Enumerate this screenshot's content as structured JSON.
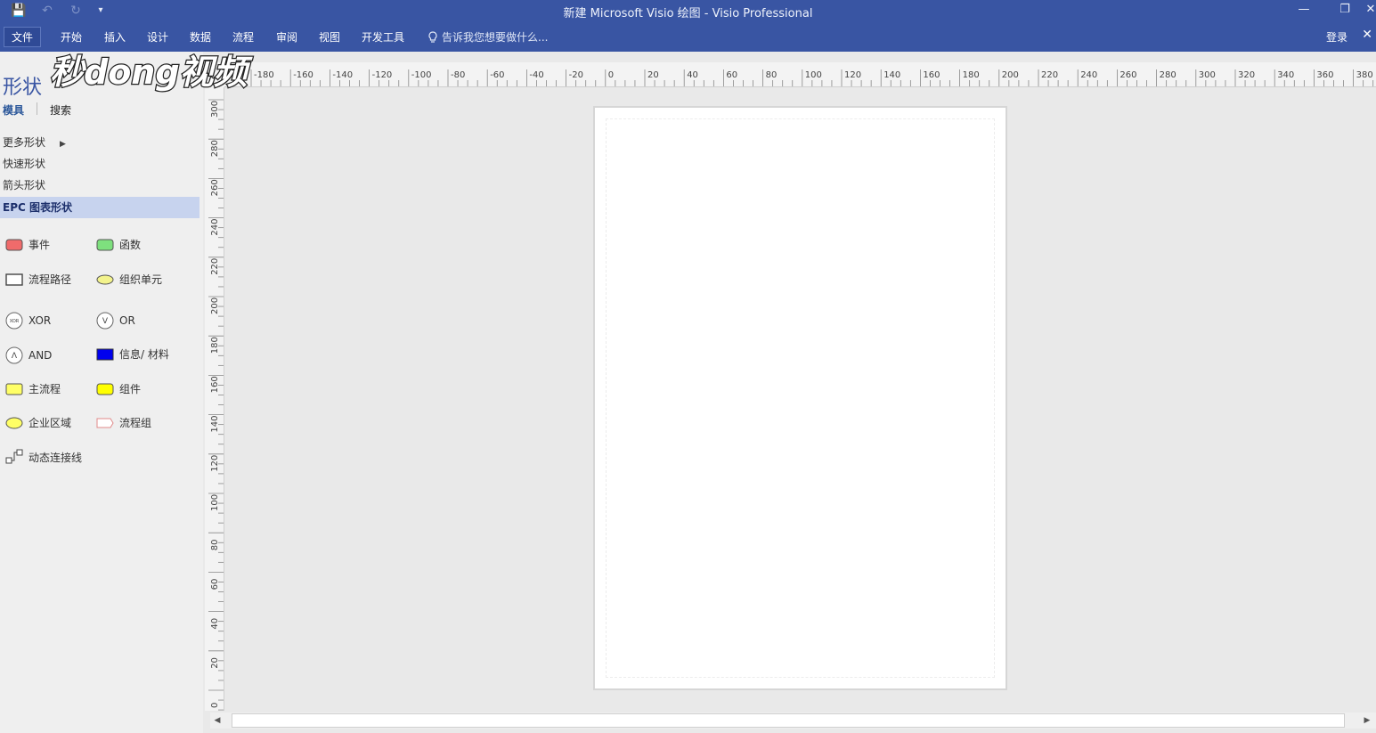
{
  "window": {
    "title": "新建 Microsoft Visio 绘图 - Visio Professional",
    "minimize": "—",
    "restore": "❐",
    "close": "✕"
  },
  "qat": {
    "save_icon": "💾",
    "undo_icon": "↶",
    "redo_icon": "↻",
    "customize_icon": "▾"
  },
  "menu": {
    "tabs": [
      {
        "label": "文件"
      },
      {
        "label": "开始"
      },
      {
        "label": "插入"
      },
      {
        "label": "设计"
      },
      {
        "label": "数据"
      },
      {
        "label": "流程"
      },
      {
        "label": "审阅"
      },
      {
        "label": "视图"
      },
      {
        "label": "开发工具"
      }
    ],
    "tell_me": "告诉我您想要做什么...",
    "login": "登录",
    "ribbon_close": "✕"
  },
  "shapes_pane": {
    "title": "形状",
    "subtabs": [
      "模具",
      "搜索"
    ],
    "nav": [
      {
        "label": "更多形状"
      },
      {
        "label": "快速形状"
      },
      {
        "label": "箭头形状"
      },
      {
        "label": "EPC 图表形状"
      }
    ],
    "stencils": [
      {
        "label": "事件",
        "icon": "rounded-rect-red",
        "color": "#f06b6b"
      },
      {
        "label": "函数",
        "icon": "rounded-rect-green",
        "color": "#7ee07e"
      },
      {
        "label": "流程路径",
        "icon": "rect-outline",
        "color": "#ffffff"
      },
      {
        "label": "组织单元",
        "icon": "ellipse-yellow",
        "color": "#f3f38c"
      },
      {
        "label": "XOR",
        "icon": "xor-circle",
        "glyph": "XOR"
      },
      {
        "label": "OR",
        "icon": "or-circle",
        "glyph": "V"
      },
      {
        "label": "AND",
        "icon": "and-circle",
        "glyph": "Λ"
      },
      {
        "label": "信息/ 材料",
        "icon": "rect-blue",
        "color": "#0000ee"
      },
      {
        "label": "主流程",
        "icon": "rect-yellow",
        "color": "#ffff66"
      },
      {
        "label": "组件",
        "icon": "rounded-rect-yellow",
        "color": "#ffff00"
      },
      {
        "label": "企业区域",
        "icon": "ellipse-yellow-2",
        "color": "#ffff66"
      },
      {
        "label": "流程组",
        "icon": "chevron-outline",
        "color": "#ffffff"
      },
      {
        "label": "动态连接线",
        "icon": "connector-icon"
      }
    ]
  },
  "watermark": {
    "text": "秒懂视频"
  },
  "ruler": {
    "h_labels": [
      "-180",
      "-160",
      "-140",
      "-120",
      "-100",
      "-80",
      "-60",
      "-40",
      "-20",
      "0",
      "20",
      "40",
      "60",
      "80",
      "100",
      "120",
      "140",
      "160",
      "180",
      "200",
      "220",
      "240",
      "260",
      "280",
      "300",
      "320",
      "340",
      "360",
      "380"
    ],
    "v_labels": [
      "300",
      "280",
      "260",
      "240",
      "220",
      "200",
      "180",
      "160",
      "140",
      "120",
      "100",
      "80",
      "60",
      "40",
      "20",
      "0"
    ]
  },
  "scrollbar": {
    "left_arrow": "◀",
    "right_arrow": "▶"
  }
}
